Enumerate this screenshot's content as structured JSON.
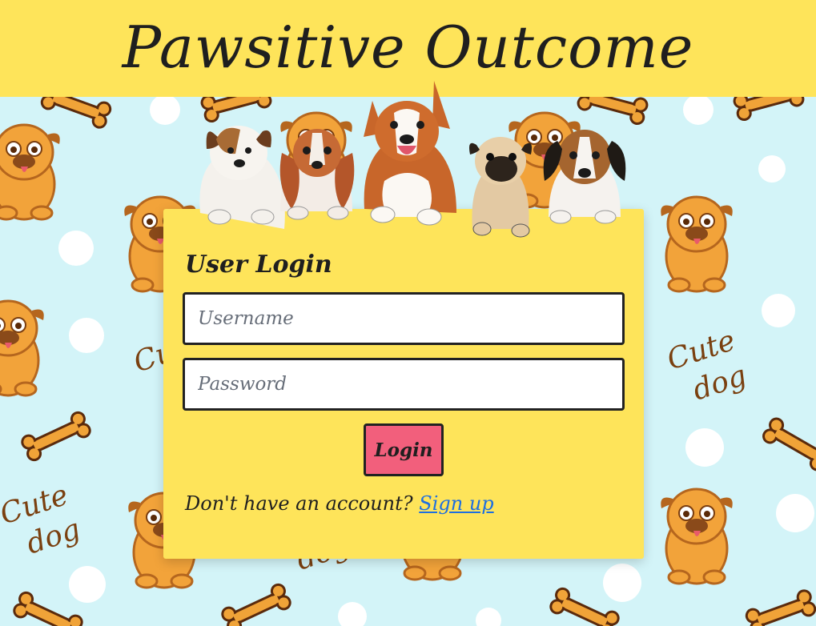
{
  "header": {
    "title": "Pawsitive Outcome"
  },
  "background": {
    "pattern_text": "Cute dog",
    "pattern_line1": "Cute",
    "pattern_line2": "dog"
  },
  "login": {
    "title": "User Login",
    "username_placeholder": "Username",
    "username_value": "",
    "password_placeholder": "Password",
    "password_value": "",
    "button_label": "Login",
    "signup_prompt": "Don't have an account?",
    "signup_link": "Sign up"
  },
  "colors": {
    "header_bg": "#fee45a",
    "page_bg": "#d3f4f8",
    "card_bg": "#fee45a",
    "button_bg": "#f25f7c",
    "link": "#1e6fe0",
    "text": "#1f1f1f"
  }
}
